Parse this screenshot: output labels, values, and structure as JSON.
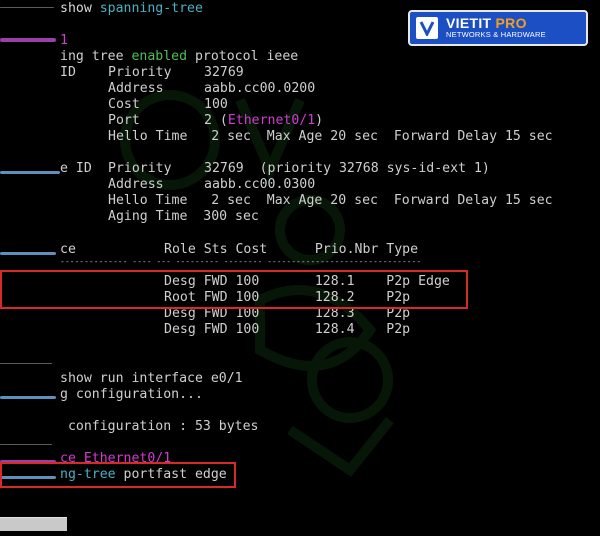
{
  "brand": {
    "name_main": "VIETIT",
    "name_accent": " PRO",
    "tagline": "NETWORKS & HARDWARE",
    "colors": {
      "panel": "#1d4fc4",
      "accent": "#f0a020"
    }
  },
  "terminal": {
    "show_cmd": {
      "prefix": "show ",
      "arg": "spanning-tree"
    },
    "vlan_id": "1",
    "protocol_line": {
      "a": "ing tree ",
      "b": "enabled",
      "c": " protocol ieee"
    },
    "root_id": {
      "label": "ID",
      "priority_label": "Priority",
      "priority": "32769",
      "address_label": "Address",
      "address": "aabb.cc00.0200",
      "cost_label": "Cost",
      "cost": "100",
      "port_label": "Port",
      "port_num": "2 (",
      "port_name": "Ethernet0/1",
      "port_close": ")",
      "timers": "Hello Time   2 sec  Max Age 20 sec  Forward Delay 15 sec"
    },
    "bridge_id": {
      "label": "e ID",
      "priority_label": "Priority",
      "priority": "32769  (priority 32768 sys-id-ext 1)",
      "address_label": "Address",
      "address": "aabb.cc00.0300",
      "timers": "Hello Time   2 sec  Max Age 20 sec  Forward Delay 15 sec",
      "aging": "Aging Time  300 sec"
    },
    "table": {
      "col_interface": "ce",
      "headers": "Role Sts Cost      Prio.Nbr Type",
      "separator": "-------------- ---- --- --------- -------- --------------------------------",
      "rows": [
        "Desg FWD 100       128.1    P2p Edge",
        "Root FWD 100       128.2    P2p",
        "Desg FWD 100       128.3    P2p",
        "Desg FWD 100       128.4    P2p"
      ]
    },
    "run_cmd": "show run interface e0/1",
    "building": "g configuration...",
    "current_conf": " configuration : 53 bytes",
    "interface_line": "ce Ethernet0/1",
    "portfast": {
      "a": "ng-tree",
      "b": " portfast edge"
    }
  }
}
